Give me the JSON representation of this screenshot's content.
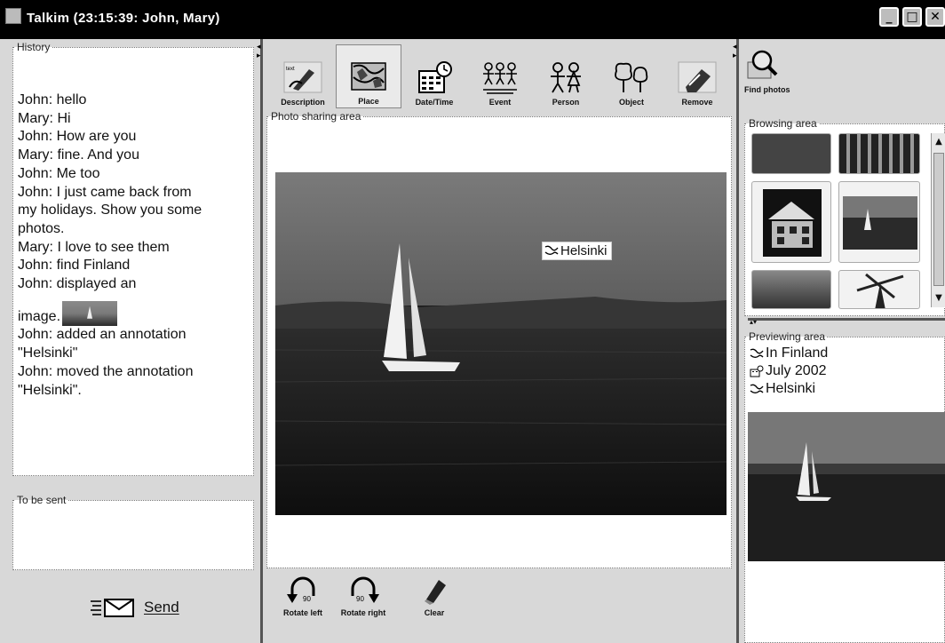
{
  "window": {
    "title": "Talkim (23:15:39: John, Mary)",
    "controls": [
      "_",
      "□",
      "✕"
    ]
  },
  "history": {
    "legend": "History",
    "lines": [
      "John: hello",
      "Mary: Hi",
      "John: How are you",
      "Mary: fine. And you",
      "John: Me too",
      "John: I just came back from",
      "my holidays. Show you some",
      "photos.",
      "Mary: I love to see them",
      "John: find Finland",
      "John: displayed an",
      "image.",
      "John: added an annotation",
      "\"Helsinki\"",
      "John: moved the annotation",
      "\"Helsinki\"."
    ]
  },
  "to_be_sent": {
    "legend": "To be sent",
    "value": ""
  },
  "send_button": {
    "label": "Send"
  },
  "toolbar": {
    "items": [
      {
        "label": "Description",
        "icon": "description-icon"
      },
      {
        "label": "Place",
        "icon": "place-icon",
        "active": true
      },
      {
        "label": "Date/Time",
        "icon": "calendar-icon"
      },
      {
        "label": "Event",
        "icon": "event-icon"
      },
      {
        "label": "Person",
        "icon": "person-icon"
      },
      {
        "label": "Object",
        "icon": "object-icon"
      },
      {
        "label": "Remove",
        "icon": "remove-icon"
      }
    ]
  },
  "photo_sharing": {
    "legend": "Photo sharing area",
    "annotation": "Helsinki"
  },
  "bottom_toolbar": {
    "items": [
      {
        "label": "Rotate left",
        "icon": "rotate-left-icon"
      },
      {
        "label": "Rotate right",
        "icon": "rotate-right-icon"
      },
      {
        "label": "Clear",
        "icon": "eraser-icon"
      }
    ]
  },
  "find_photos": {
    "label": "Find photos"
  },
  "browsing": {
    "legend": "Browsing area"
  },
  "previewing": {
    "legend": "Previewing area",
    "place": "In Finland",
    "date": "July 2002",
    "annotation": "Helsinki"
  },
  "colors": {
    "titlebar": "#000000",
    "panel": "#d8d8d8",
    "photo_dark": "#1c1c1c"
  }
}
